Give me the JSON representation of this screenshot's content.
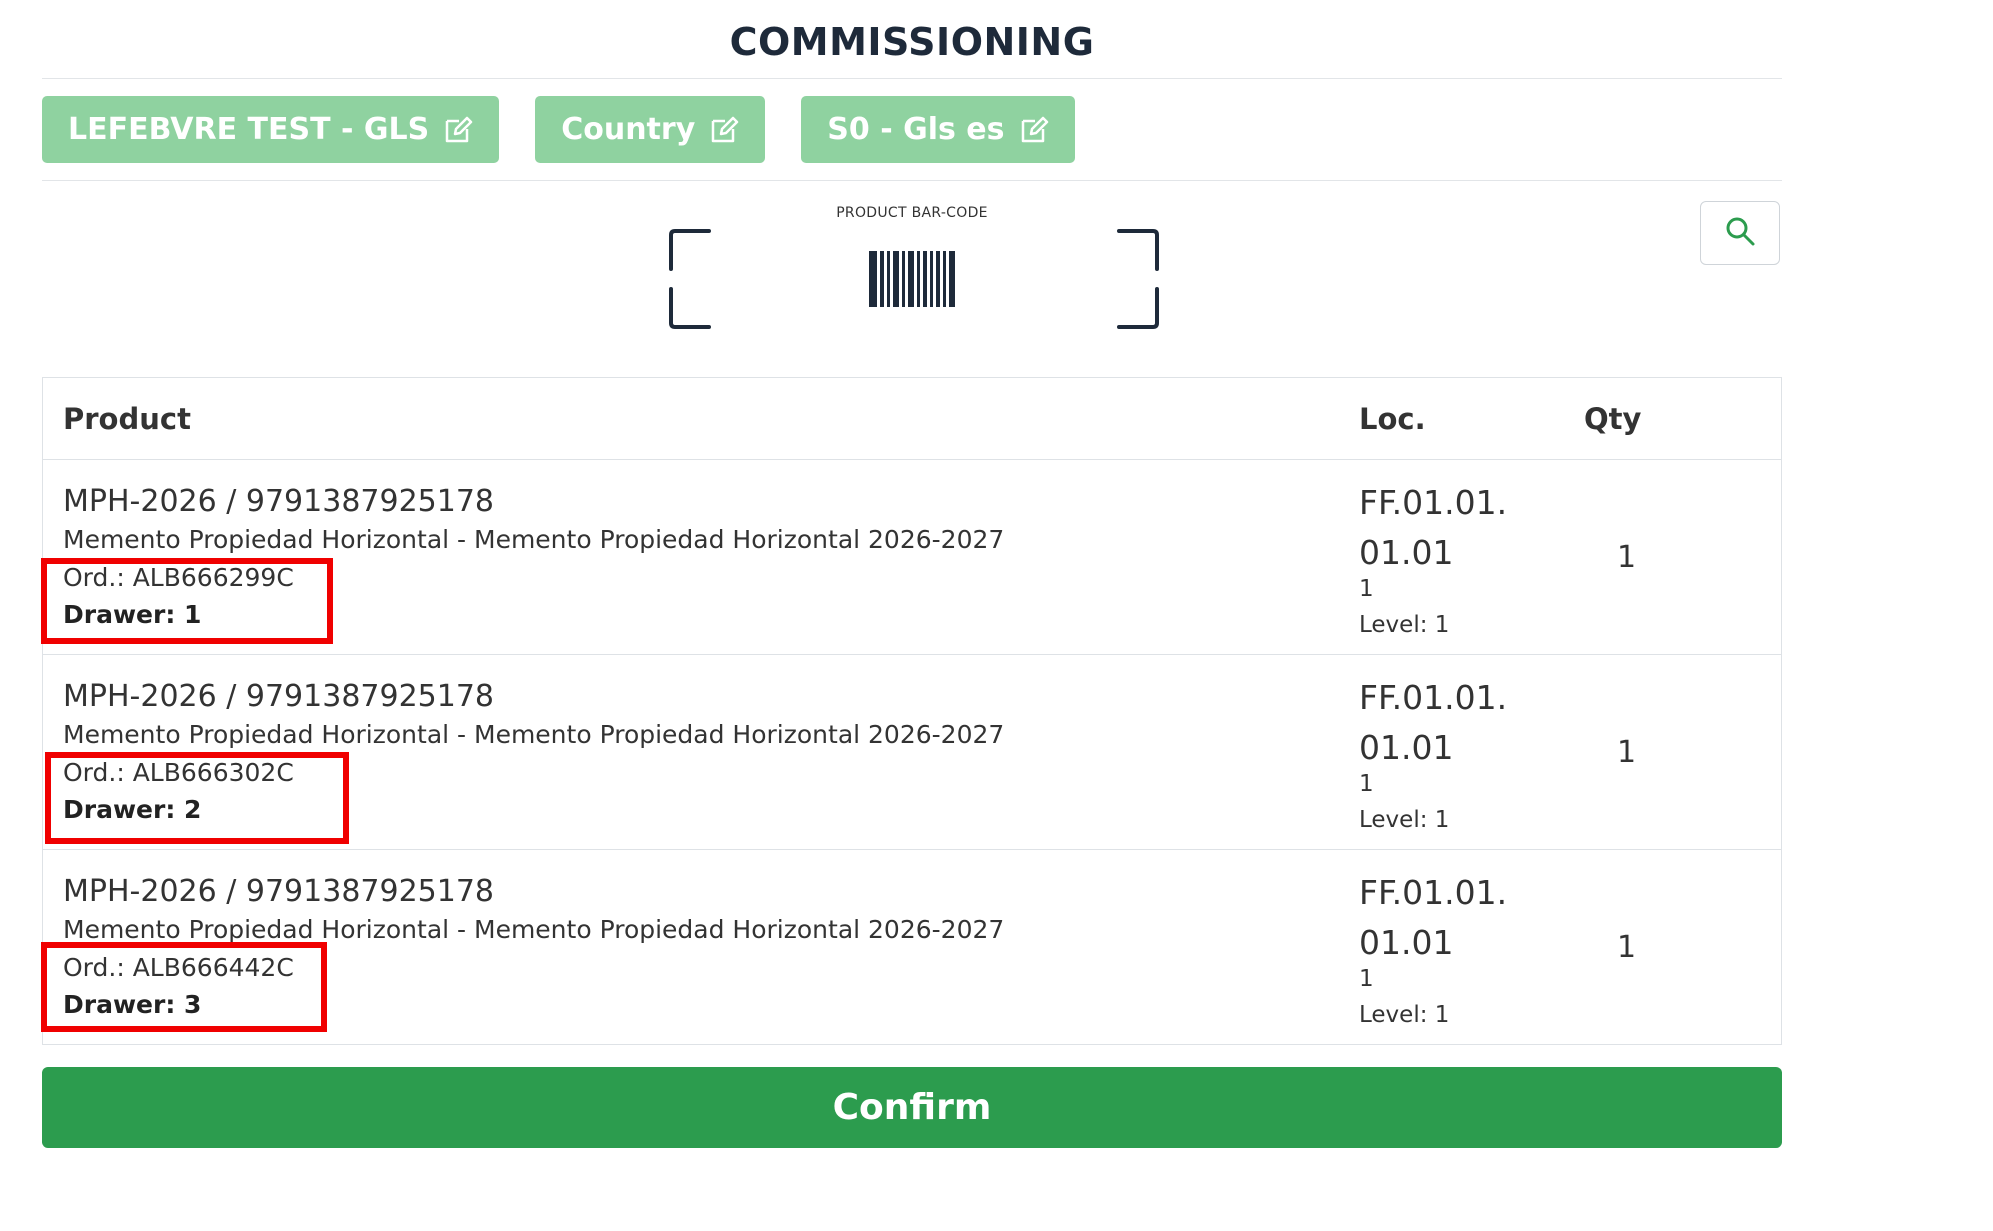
{
  "page": {
    "title": "COMMISSIONING"
  },
  "chips": [
    {
      "label": "LEFEBVRE TEST - GLS",
      "icon": "edit-icon"
    },
    {
      "label": "Country",
      "icon": "edit-icon"
    },
    {
      "label": "S0 - Gls es",
      "icon": "edit-icon"
    }
  ],
  "scanner": {
    "label": "PRODUCT BAR-CODE",
    "icon": "barcode-scan-icon"
  },
  "search": {
    "icon": "search-icon"
  },
  "table": {
    "headers": {
      "product": "Product",
      "loc": "Loc.",
      "qty": "Qty"
    },
    "rows": [
      {
        "title": "MPH-2026 / 9791387925178",
        "description": "Memento Propiedad Horizontal - Memento Propiedad Horizontal 2026-2027",
        "order": "Ord.: ALB666299C",
        "drawer": "Drawer: 1",
        "loc_line1": "FF.01.01.",
        "loc_line2": "01.01",
        "loc_sub": "1",
        "level": "Level: 1",
        "qty": "1"
      },
      {
        "title": "MPH-2026 / 9791387925178",
        "description": "Memento Propiedad Horizontal - Memento Propiedad Horizontal 2026-2027",
        "order": "Ord.: ALB666302C",
        "drawer": "Drawer: 2",
        "loc_line1": "FF.01.01.",
        "loc_line2": "01.01",
        "loc_sub": "1",
        "level": "Level: 1",
        "qty": "1"
      },
      {
        "title": "MPH-2026 / 9791387925178",
        "description": "Memento Propiedad Horizontal - Memento Propiedad Horizontal 2026-2027",
        "order": "Ord.: ALB666442C",
        "drawer": "Drawer: 3",
        "loc_line1": "FF.01.01.",
        "loc_line2": "01.01",
        "loc_sub": "1",
        "level": "Level: 1",
        "qty": "1"
      }
    ]
  },
  "confirm": {
    "label": "Confirm"
  },
  "colors": {
    "accent": "#2c9c4e",
    "chip": "#8fd2a0",
    "highlight": "#f00000",
    "title": "#1e2a3a"
  }
}
